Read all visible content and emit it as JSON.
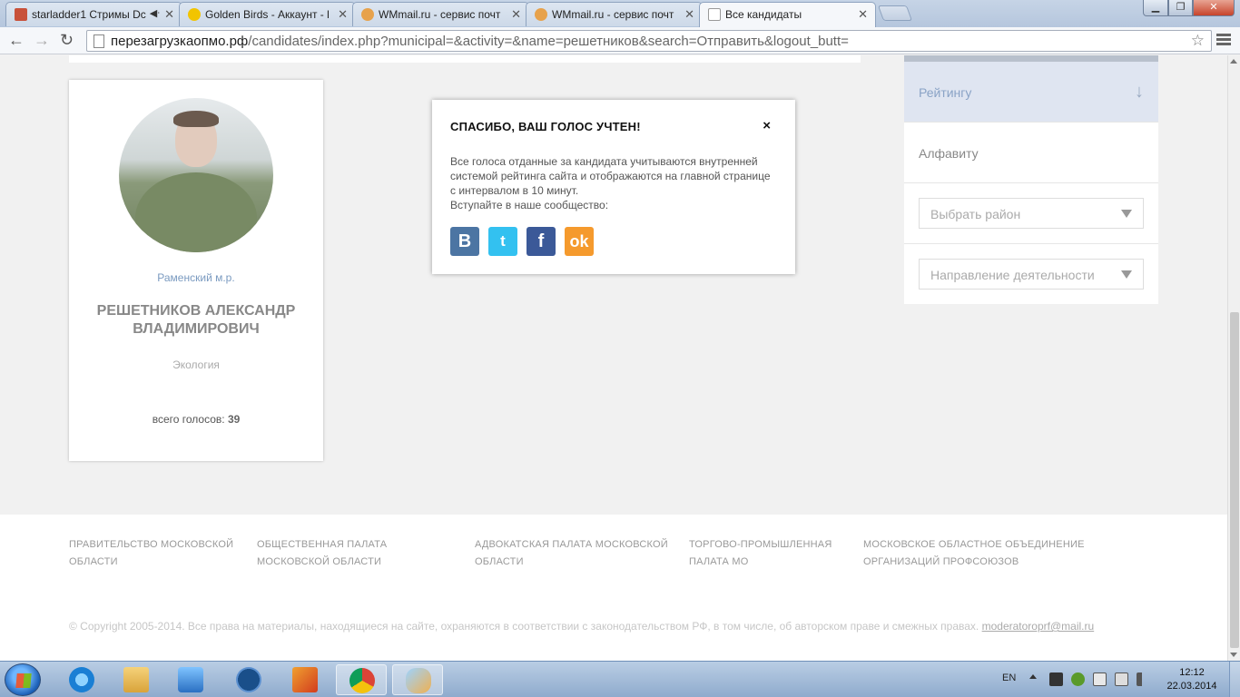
{
  "browser": {
    "tabs": [
      {
        "title": "starladder1 Стримы Dc",
        "audio": "◀ᐧ",
        "favicon_color": "#c8513a"
      },
      {
        "title": "Golden Birds - Аккаунт - l",
        "favicon_color": "#f2c400"
      },
      {
        "title": "WMmail.ru - сервис почт",
        "favicon_color": "#e7a24c"
      },
      {
        "title": "WMmail.ru - сервис почт",
        "favicon_color": "#e7a24c"
      },
      {
        "title": "Все кандидаты",
        "favicon_color": "#ffffff"
      }
    ],
    "url_host": "перезагрузкаопмо.рф",
    "url_path": "/candidates/index.php?municipal=&activity=&name=решетников&search=Отправить&logout_butt="
  },
  "candidate": {
    "municipal": "Раменский м.р.",
    "name": "РЕШЕТНИКОВ АЛЕКСАНДР ВЛАДИМИРОВИЧ",
    "activity": "Экология",
    "votes_label": "всего голосов:",
    "votes_count": "39"
  },
  "sidebar": {
    "sort_rating": "Рейтингу",
    "sort_alpha": "Алфавиту",
    "district_placeholder": "Выбрать район",
    "direction_placeholder": "Направление деятельности"
  },
  "modal": {
    "title": "СПАСИБО, ВАШ ГОЛОС УЧТЕН!",
    "text": "Все голоса отданные за кандидата учитываются внутренней системой рейтинга сайта и отображаются на главной странице с интервалом в 10 минут.",
    "join": "Вступайте в наше сообщество:",
    "close": "×",
    "socials": [
      {
        "name": "vkontakte",
        "glyph": "B"
      },
      {
        "name": "twitter",
        "glyph": "t"
      },
      {
        "name": "facebook",
        "glyph": "f"
      },
      {
        "name": "odnoklassniki",
        "glyph": "ok"
      }
    ]
  },
  "footer": {
    "links": [
      "ПРАВИТЕЛЬСТВО МОСКОВСКОЙ ОБЛАСТИ",
      "ОБЩЕСТВЕННАЯ ПАЛАТА МОСКОВСКОЙ ОБЛАСТИ",
      "АДВОКАТСКАЯ ПАЛАТА МОСКОВСКОЙ ОБЛАСТИ",
      "ТОРГОВО-ПРОМЫШЛЕННАЯ ПАЛАТА МО",
      "МОСКОВСКОЕ ОБЛАСТНОЕ ОБЪЕДИНЕНИЕ ОРГАНИЗАЦИЙ ПРОФСОЮЗОВ"
    ],
    "copyright": "© Copyright 2005-2014. Все права на материалы, находящиеся на сайте, охраняются в соответствии с законодательством РФ, в том числе, об авторском праве и смежных правах.",
    "email": "moderatoroprf@mail.ru"
  },
  "taskbar": {
    "lang": "EN",
    "time": "12:12",
    "date": "22.03.2014"
  }
}
